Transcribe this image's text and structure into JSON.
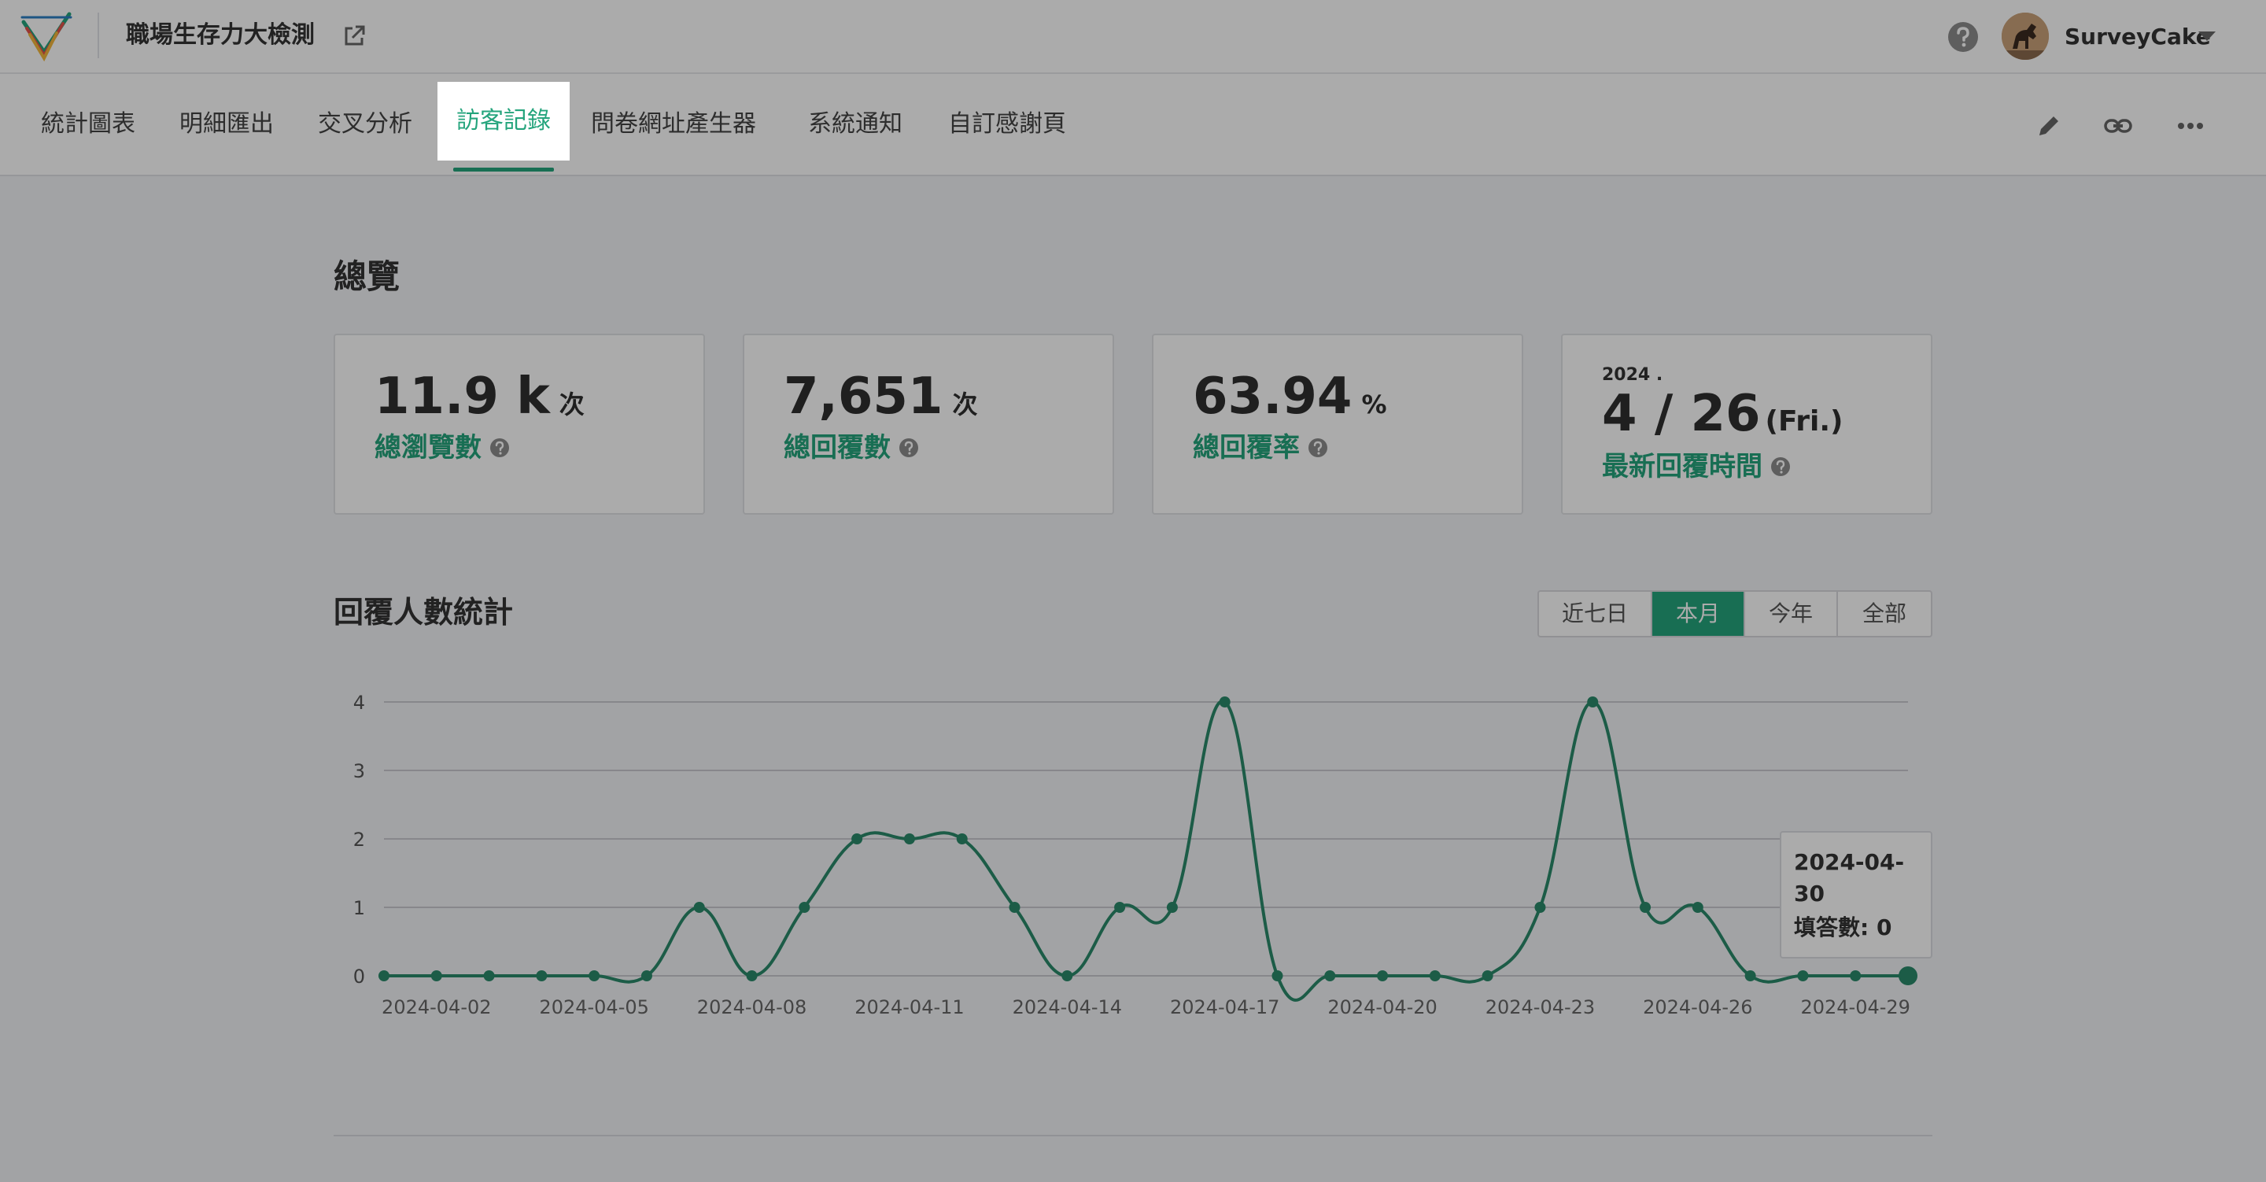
{
  "header": {
    "survey_title": "職場生存力大檢測",
    "user_name": "SurveyCake"
  },
  "tabs": [
    {
      "label": "統計圖表"
    },
    {
      "label": "明細匯出"
    },
    {
      "label": "交叉分析"
    },
    {
      "label": "訪客記錄",
      "active": true
    },
    {
      "label": "問卷網址產生器"
    },
    {
      "label": "系統通知"
    },
    {
      "label": "自訂感謝頁"
    }
  ],
  "overview": {
    "title": "總覽",
    "views": {
      "value": "11.9 k",
      "unit": "次",
      "label": "總瀏覽數"
    },
    "responses": {
      "value": "7,651",
      "unit": "次",
      "label": "總回覆數"
    },
    "rate": {
      "value": "63.94",
      "unit": "%",
      "label": "總回覆率"
    },
    "latest": {
      "year": "2024 .",
      "date": "4 / 26",
      "weekday": "(Fri.)",
      "label": "最新回覆時間"
    }
  },
  "stats": {
    "title": "回覆人數統計",
    "ranges": [
      {
        "label": "近七日"
      },
      {
        "label": "本月",
        "selected": true
      },
      {
        "label": "今年"
      },
      {
        "label": "全部"
      }
    ]
  },
  "tooltip": {
    "date": "2024-04-30",
    "count_text": "填答數: 0"
  },
  "colors": {
    "accent": "#24a47c",
    "line": "#2a8a6a"
  },
  "chart_data": {
    "type": "line",
    "x": [
      "2024-04-01",
      "2024-04-02",
      "2024-04-03",
      "2024-04-04",
      "2024-04-05",
      "2024-04-06",
      "2024-04-07",
      "2024-04-08",
      "2024-04-09",
      "2024-04-10",
      "2024-04-11",
      "2024-04-12",
      "2024-04-13",
      "2024-04-14",
      "2024-04-15",
      "2024-04-16",
      "2024-04-17",
      "2024-04-18",
      "2024-04-19",
      "2024-04-20",
      "2024-04-21",
      "2024-04-22",
      "2024-04-23",
      "2024-04-24",
      "2024-04-25",
      "2024-04-26",
      "2024-04-27",
      "2024-04-28",
      "2024-04-29",
      "2024-04-30"
    ],
    "series": [
      {
        "values": [
          0,
          0,
          0,
          0,
          0,
          0,
          1,
          0,
          1,
          2,
          2,
          2,
          1,
          0,
          1,
          1,
          4,
          0,
          0,
          0,
          0,
          0,
          1,
          4,
          1,
          1,
          0,
          0,
          0,
          0
        ]
      }
    ],
    "x_tick_labels": [
      "2024-04-02",
      "2024-04-05",
      "2024-04-08",
      "2024-04-11",
      "2024-04-14",
      "2024-04-17",
      "2024-04-20",
      "2024-04-23",
      "2024-04-26",
      "2024-04-29"
    ],
    "y_ticks": [
      "0",
      "1",
      "2",
      "3",
      "4"
    ],
    "ylim": [
      0,
      4
    ],
    "grid": true
  }
}
